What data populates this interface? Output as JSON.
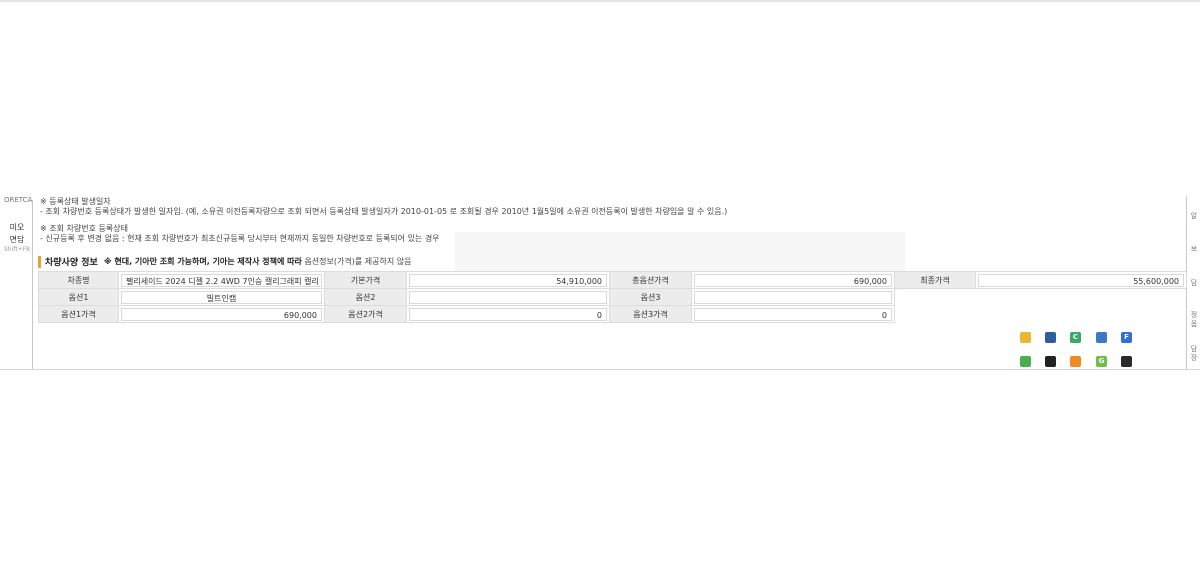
{
  "left_sidebar": {
    "top_label": "ORETCA",
    "item_icon": "미오",
    "item_label": "면담",
    "shortcut": "Shift+F8"
  },
  "right_sidebar": {
    "labels": [
      "알",
      "보",
      "담",
      "정",
      "옵",
      "담",
      "장"
    ]
  },
  "notes": {
    "reg_date_title": "※ 등록상태 발생일자",
    "reg_date_desc": "- 조회 차량번호 등록상태가 발생한 일자임. (예, 소유권 이전등록차량으로 조회 되면서 등록상태 발생일자가 2010-01-05 로 조회될 경우 2010년 1월5일에 소유권 이전등록이 발생한 차량임을 알 수 있음.)",
    "reg_state_title": "※ 조회 차량번호 등록상태",
    "reg_state_desc": "- 신규등록 후 변경 없음 : 현재 조회 차량번호가 최초신규등록 당시부터 현재까지 동일한 차량번호로 등록되어 있는 경우"
  },
  "section": {
    "title": "차량사양 정보",
    "sub_prefix": "※ 현대, 기아만 조회 가능하며, 기아는 제작사 정책에 따라",
    "sub_suffix": "옵션정보(가격)를 제공하지 않음"
  },
  "spec": {
    "labels": {
      "car_name": "차종명",
      "base_price": "기본가격",
      "option_total": "총옵션가격",
      "final_price": "최종가격",
      "option1": "옵션1",
      "option2": "옵션2",
      "option3": "옵션3",
      "option1_price": "옵션1가격",
      "option2_price": "옵션2가격",
      "option3_price": "옵션3가격"
    },
    "values": {
      "car_name": "팰리세이드 2024 디젤 2.2 4WD 7인승 캘리그래피 캘리",
      "base_price": "54,910,000",
      "option_total": "690,000",
      "final_price": "55,600,000",
      "option1": "빌트인캠",
      "option2": "",
      "option3": "",
      "option1_price": "690,000",
      "option2_price": "0",
      "option3_price": "0"
    }
  },
  "tray_icons": [
    {
      "name": "folder-icon",
      "color": "#e8b830",
      "glyph": ""
    },
    {
      "name": "shield-icon",
      "color": "#2d5fa0",
      "glyph": ""
    },
    {
      "name": "refresh-icon",
      "color": "#3aa86b",
      "glyph": "C"
    },
    {
      "name": "diamond-icon",
      "color": "#3b78c6",
      "glyph": ""
    },
    {
      "name": "f-app-icon",
      "color": "#2f6fd6",
      "glyph": "F"
    },
    {
      "name": "pin-icon",
      "color": "#4bb04b",
      "glyph": ""
    },
    {
      "name": "grid-icon",
      "color": "#222222",
      "glyph": ""
    },
    {
      "name": "app-orange-icon",
      "color": "#f08a24",
      "glyph": ""
    },
    {
      "name": "g-app-icon",
      "color": "#6cc04a",
      "glyph": "G"
    },
    {
      "name": "camera-icon",
      "color": "#2a2a2a",
      "glyph": ""
    }
  ]
}
